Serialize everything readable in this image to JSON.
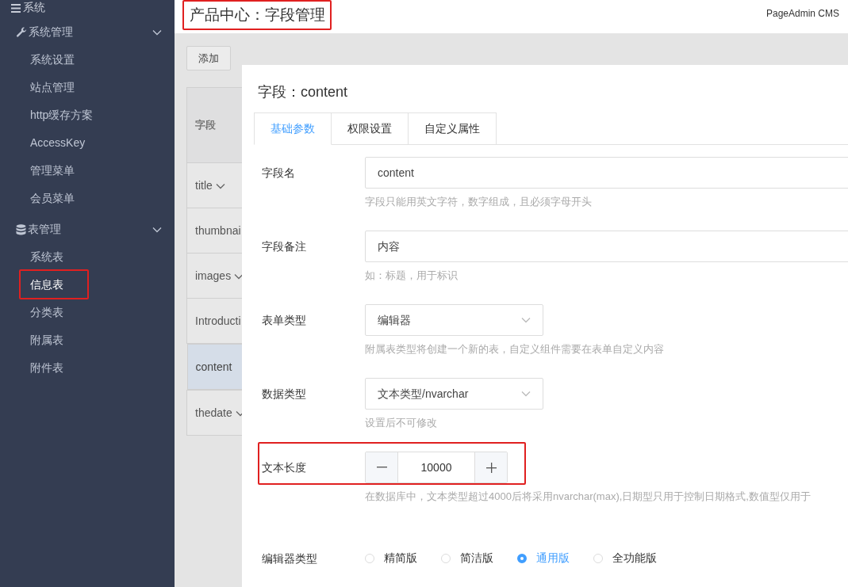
{
  "sidebar": {
    "heading": "系统",
    "groups": [
      {
        "label": "系统管理",
        "expanded": true,
        "items": [
          {
            "label": "系统设置",
            "selected": false,
            "highlighted": false
          },
          {
            "label": "站点管理",
            "selected": false,
            "highlighted": false
          },
          {
            "label": "http缓存方案",
            "selected": false,
            "highlighted": false
          },
          {
            "label": "AccessKey",
            "selected": false,
            "highlighted": false
          },
          {
            "label": "管理菜单",
            "selected": false,
            "highlighted": false
          },
          {
            "label": "会员菜单",
            "selected": false,
            "highlighted": false
          }
        ]
      },
      {
        "label": "表管理",
        "expanded": true,
        "items": [
          {
            "label": "系统表",
            "selected": false,
            "highlighted": false
          },
          {
            "label": "信息表",
            "selected": true,
            "highlighted": true
          },
          {
            "label": "分类表",
            "selected": false,
            "highlighted": false
          },
          {
            "label": "附属表",
            "selected": false,
            "highlighted": false
          },
          {
            "label": "附件表",
            "selected": false,
            "highlighted": false
          }
        ]
      }
    ]
  },
  "header": {
    "title": "产品中心：字段管理",
    "title_highlighted": true,
    "brand": "PageAdmin CMS"
  },
  "toolbar": {
    "add_button": "添加"
  },
  "table": {
    "columns": [
      "字段"
    ],
    "rows": [
      {
        "cell": "title",
        "selected": false
      },
      {
        "cell": "thumbnai",
        "selected": false
      },
      {
        "cell": "images",
        "selected": false
      },
      {
        "cell": "Introducti",
        "selected": false
      },
      {
        "cell": "content",
        "selected": true
      },
      {
        "cell": "thedate",
        "selected": false
      }
    ]
  },
  "panel": {
    "title": "字段：content",
    "tabs": [
      {
        "label": "基础参数",
        "selected": true
      },
      {
        "label": "权限设置",
        "selected": false
      },
      {
        "label": "自定义属性",
        "selected": false
      }
    ],
    "form": [
      {
        "kind": "text",
        "label": "字段名",
        "value": "content",
        "hint": "字段只能用英文字符，数字组成，且必须字母开头"
      },
      {
        "kind": "text",
        "label": "字段备注",
        "value": "内容",
        "hint": "如：标题，用于标识"
      },
      {
        "kind": "select",
        "label": "表单类型",
        "value": "编辑器",
        "hint": "附属表类型将创建一个新的表，自定义组件需要在表单自定义内容"
      },
      {
        "kind": "select",
        "label": "数据类型",
        "value": "文本类型/nvarchar",
        "hint": "设置后不可修改"
      },
      {
        "kind": "stepper",
        "label": "文本长度",
        "value": "10000",
        "hint": "在数据库中，文本类型超过4000后将采用nvarchar(max),日期型只用于控制日期格式,数值型仅用于",
        "highlighted": true
      },
      {
        "kind": "radio",
        "label": "编辑器类型",
        "options": [
          {
            "label": "精简版",
            "selected": false
          },
          {
            "label": "简洁版",
            "selected": false
          },
          {
            "label": "通用版",
            "selected": true
          },
          {
            "label": "全功能版",
            "selected": false
          }
        ]
      },
      {
        "kind": "edge"
      }
    ]
  }
}
